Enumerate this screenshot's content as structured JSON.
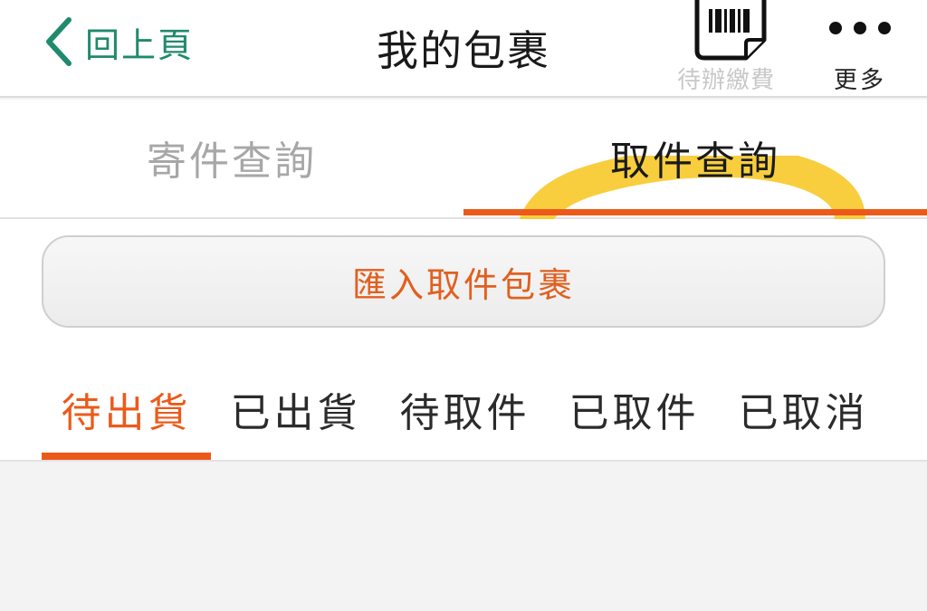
{
  "header": {
    "back_label": "回上頁",
    "title": "我的包裹",
    "pending_payment_label": "待辦繳費",
    "more_label": "更多"
  },
  "mode_tabs": [
    {
      "label": "寄件查詢",
      "active": false
    },
    {
      "label": "取件查詢",
      "active": true
    }
  ],
  "import_button": {
    "label": "匯入取件包裹"
  },
  "status_tabs": [
    {
      "label": "待出貨",
      "active": true
    },
    {
      "label": "已出貨",
      "active": false
    },
    {
      "label": "待取件",
      "active": false
    },
    {
      "label": "已取件",
      "active": false
    },
    {
      "label": "已取消",
      "active": false
    }
  ],
  "icons": {
    "back": "chevron-left-icon",
    "pending_payment": "barcode-bill-icon",
    "more": "more-dots-icon"
  },
  "colors": {
    "accent_orange": "#ec5a1a",
    "back_green": "#1f8a6d",
    "highlight_yellow": "#f7c51c"
  }
}
